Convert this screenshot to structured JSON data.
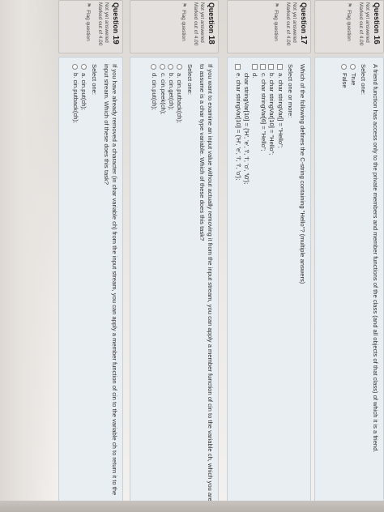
{
  "questions": [
    {
      "number_label": "Question",
      "number": "16",
      "status": "Not yet answered",
      "marks": "Marked out of 4.00",
      "flag_label": "Flag question",
      "text": "A friend function has access only to the private members and member functions of the class (and all objects of that class) of which it is a friend.",
      "select_label": "Select one:",
      "input_type": "radio",
      "options": [
        "True",
        "False"
      ]
    },
    {
      "number_label": "Question",
      "number": "17",
      "status": "Not yet answered",
      "marks": "Marked out of 4.00",
      "flag_label": "Flag question",
      "text": "Which of the following defines the C-string containing \"Hello\"? (multiple answers)",
      "select_label": "Select one or more:",
      "input_type": "checkbox",
      "options": [
        "a. char stringVar[] = \"Hello\";",
        "b. char stringVar[10] = \"Hello\";",
        "c. char stringVar[6] = \"Hello\";",
        "d.",
        "char stringVar[10] = {'H', 'e', 'l', 'l', 'o', '\\0'};",
        "e. char stringVar[10] = {'H', 'e', 'l', 'l', 'o'};"
      ]
    },
    {
      "number_label": "Question",
      "number": "18",
      "status": "Not yet answered",
      "marks": "Marked out of 4.00",
      "flag_label": "Flag question",
      "text": "If you want to examine an input value without actually removing it from the input stream, you can apply a member function of cin to the variable ch, which you are to assume is a char type variable. Which of these does this task?",
      "select_label": "Select one:",
      "input_type": "radio",
      "options": [
        "a. cin.putback(ch);",
        "b. cin.get(ch);",
        "c. cin.peek(ch);",
        "d. cin.put(ch);"
      ]
    },
    {
      "number_label": "Question",
      "number": "19",
      "status": "Not yet answered",
      "marks": "Marked out of 4.00",
      "flag_label": "Flag question",
      "text": "If you have already removed a character (in char variable ch) from the input stream, you can apply a member function of cin to the variable ch to return it to the input stream. Which of these does this task?",
      "select_label": "Select one:",
      "input_type": "radio",
      "options": [
        "a. cin.put(ch);",
        "b. cin.putback(ch);"
      ]
    }
  ]
}
